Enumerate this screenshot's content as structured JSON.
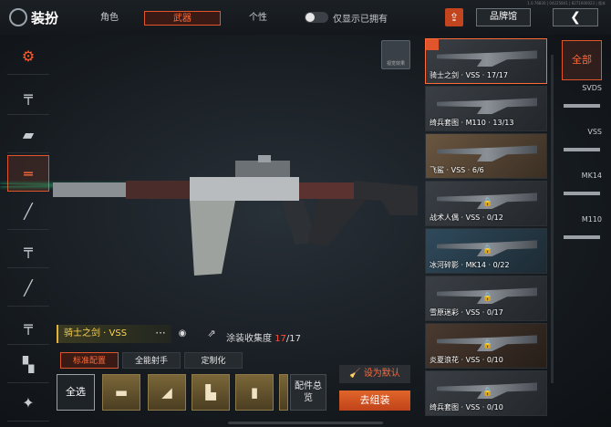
{
  "header": {
    "title": "装扮",
    "tabs": [
      {
        "label": "角色",
        "active": false
      },
      {
        "label": "武器",
        "active": true
      },
      {
        "label": "个性",
        "active": false
      }
    ],
    "owned_toggle_label": "仅显示已拥有",
    "brand_hall_label": "品牌馆",
    "close_label": "❮",
    "version_text": "1.0.76830 | 04225841 | 8271600023 | 版本"
  },
  "left_categories": [
    {
      "icon": "ambassador-icon",
      "glyph": "⚙",
      "active": false
    },
    {
      "icon": "assault-rifle-icon",
      "glyph": "╤",
      "active": false
    },
    {
      "icon": "launcher-icon",
      "glyph": "▰",
      "active": false
    },
    {
      "icon": "marksman-rifle-icon",
      "glyph": "═",
      "active": true
    },
    {
      "icon": "sniper-rifle-icon",
      "glyph": "╱",
      "active": false
    },
    {
      "icon": "smg-icon",
      "glyph": "╤",
      "active": false
    },
    {
      "icon": "shotgun-icon",
      "glyph": "╱",
      "active": false
    },
    {
      "icon": "lmg-icon",
      "glyph": "╤",
      "active": false
    },
    {
      "icon": "pistol-icon",
      "glyph": "▚",
      "active": false
    },
    {
      "icon": "melee-icon",
      "glyph": "✦",
      "active": false
    }
  ],
  "preview": {
    "scope_button_label": "视觉效果",
    "skin_name": "骑士之剑 · VSS",
    "more_label": "···",
    "collection_label": "涂装收集度",
    "collection_current": "17",
    "collection_total": "/17",
    "subtabs": [
      {
        "label": "标准配置",
        "active": true
      },
      {
        "label": "全能射手",
        "active": false
      },
      {
        "label": "定制化",
        "active": false
      }
    ],
    "select_all_label": "全选",
    "parts": [
      "muzzle",
      "stock",
      "grip",
      "magazine",
      "scope"
    ],
    "parts_overview_label": "配件总览",
    "set_default_label": "设为默认",
    "assemble_label": "去组装"
  },
  "skins": [
    {
      "label": "骑士之剑 · VSS · 17/17",
      "active": true,
      "locked": false
    },
    {
      "label": "绮兵套图 · M110 · 13/13",
      "active": false,
      "locked": false
    },
    {
      "label": "飞鲨 · VSS · 6/6",
      "active": false,
      "locked": false
    },
    {
      "label": "战术人偶 · VSS · 0/12",
      "active": false,
      "locked": true
    },
    {
      "label": "冰河碎影 · MK14 · 0/22",
      "active": false,
      "locked": true
    },
    {
      "label": "雪原迷彩 · VSS · 0/17",
      "active": false,
      "locked": true
    },
    {
      "label": "炎夏浪花 · VSS · 0/10",
      "active": false,
      "locked": true
    },
    {
      "label": "绮兵套图 · VSS · 0/10",
      "active": false,
      "locked": true
    }
  ],
  "filters": {
    "all_label": "全部",
    "items": [
      "SVDS",
      "VSS",
      "MK14",
      "M110"
    ]
  },
  "colors": {
    "accent": "#e0552c",
    "gold": "#ffd54a",
    "laser": "#26e08a"
  }
}
